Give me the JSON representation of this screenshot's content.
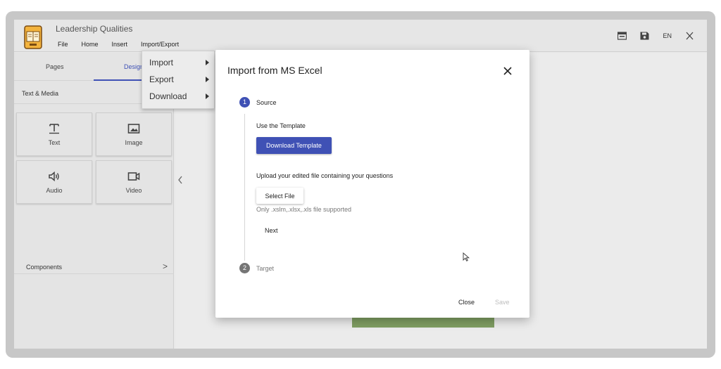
{
  "app": {
    "title": "Leadership Qualities",
    "menu": [
      "File",
      "Home",
      "Insert",
      "Import/Export"
    ],
    "language": "EN"
  },
  "left_panel": {
    "tabs": [
      "Pages",
      "Design"
    ],
    "text_media_title": "Text & Media",
    "tiles": [
      {
        "label": "Text",
        "icon": "text-icon"
      },
      {
        "label": "Image",
        "icon": "image-icon"
      },
      {
        "label": "Audio",
        "icon": "audio-icon"
      },
      {
        "label": "Video",
        "icon": "video-icon"
      }
    ],
    "components_title": "Components",
    "components_chevron": ">"
  },
  "dropdown": {
    "items": [
      "Import",
      "Export",
      "Download"
    ]
  },
  "modal": {
    "title": "Import from MS Excel",
    "steps": [
      {
        "number": "1",
        "label": "Source"
      },
      {
        "number": "2",
        "label": "Target"
      }
    ],
    "template_label": "Use the Template",
    "download_button": "Download Template",
    "upload_label": "Upload your edited file containing your questions",
    "select_button": "Select File",
    "file_hint": "Only .xslm,.xlsx,.xls file supported",
    "next_button": "Next",
    "close_button": "Close",
    "save_button": "Save"
  },
  "colors": {
    "primary": "#3f51b5",
    "step_inactive": "#757575",
    "accent_green": "#7f9e62"
  }
}
